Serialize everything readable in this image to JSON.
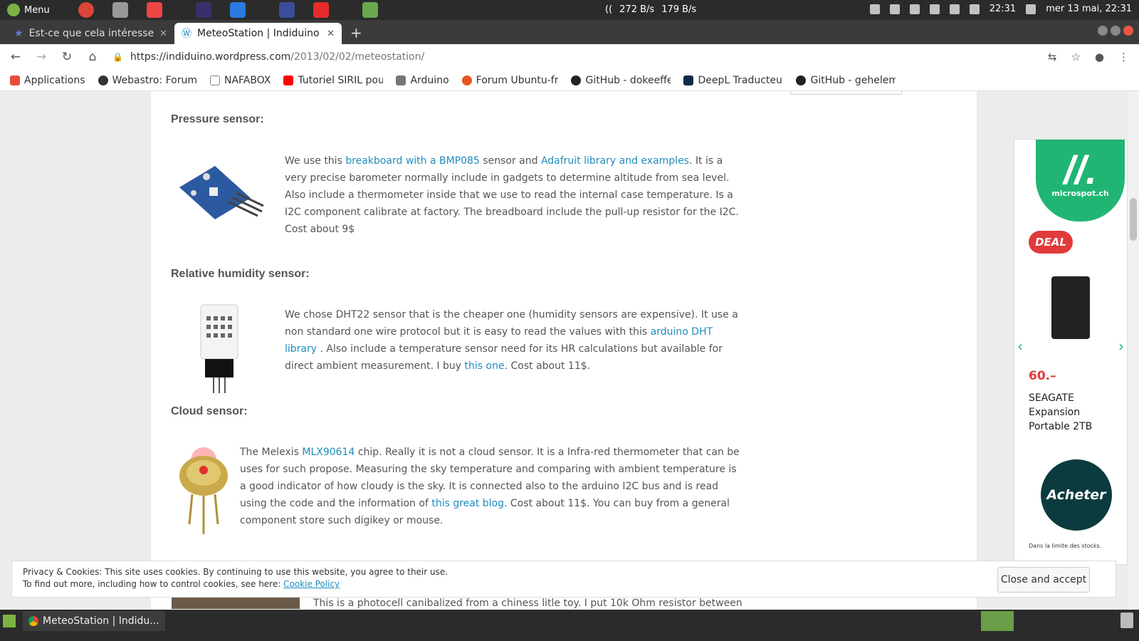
{
  "system": {
    "menu_label": "Menu",
    "net_down": "272 B/s",
    "net_up": "179 B/s",
    "time": "22:31",
    "date": "mer 13 mai, 22:31"
  },
  "tabs": [
    {
      "title": "Est-ce que cela intéresse",
      "active": false
    },
    {
      "title": "MeteoStation | Indiduino",
      "active": true
    }
  ],
  "address": {
    "host": "https://indiduino.wordpress.com",
    "path": "/2013/02/02/meteostation/"
  },
  "bookmarks": [
    {
      "label": "Applications",
      "color": "#e74c3c"
    },
    {
      "label": "Webastro: Forum",
      "color": "#333333"
    },
    {
      "label": "NAFABOX",
      "color": "#888888"
    },
    {
      "label": "Tutoriel SIRIL pour",
      "color": "#ff0000"
    },
    {
      "label": "Arduino",
      "color": "#777777"
    },
    {
      "label": "Forum Ubuntu-fr",
      "color": "#e95420"
    },
    {
      "label": "GitHub - dokeeffe",
      "color": "#222222"
    },
    {
      "label": "DeepL Traducteur",
      "color": "#0f2b46"
    },
    {
      "label": "GitHub - gehelem",
      "color": "#222222"
    }
  ],
  "article": {
    "pressure": {
      "heading": "Pressure sensor:",
      "p1": "We use this ",
      "link1": "breakboard with  a BMP085",
      "p2": " sensor and  ",
      "link2": "Adafruit library and examples",
      "p3": ". It is a very precise barometer normally include in gadgets to determine altitude from sea level. Also include a thermometer inside that we  use to read the internal case temperature. Is a I2C component calibrate at factory. The breadboard include the pull-up resistor for the I2C. Cost about 9$"
    },
    "humidity": {
      "heading": "Relative humidity sensor:",
      "p1": "We chose DHT22 sensor that is the cheaper one (humidity sensors are expensive). It use a non standard one wire protocol but it is easy to read the values with this ",
      "link1": "arduino DHT library",
      "p2": " . Also include a temperature sensor need for its HR calculations but available for direct ambient measurement. I buy ",
      "link2": "this one",
      "p3": ". Cost about 11$."
    },
    "cloud": {
      "heading": "Cloud sensor:",
      "p1": "The Melexis ",
      "link1": "MLX90614",
      "p2": " chip.  Really it is not a cloud sensor. It is a Infra-red thermometer that can be uses for such propose. Measuring the sky temperature and comparing with ambient temperature is a good indicator of how cloudy is the sky. It is connected also to the arduino I2C bus and is read using the code and the information of ",
      "link2": "this great blog",
      "p3": ". Cost about 11$. You can buy from a general component store such digikey or mouse."
    },
    "bottom_text": "This is a  photocell canibalized from a chiness litle toy. I put  10k Ohm  resistor between"
  },
  "ad": {
    "brand": "microspot.ch",
    "deal": "DEAL",
    "price": "60.–",
    "product": [
      "SEAGATE",
      "Expansion",
      "Portable 2TB"
    ],
    "cta": "Acheter",
    "stock_note": "Dans la limite des stocks.",
    "brand_color": "#21b573"
  },
  "cookie": {
    "line1": "Privacy & Cookies: This site uses cookies. By continuing to use this website, you agree to their use.",
    "line2": "To find out more, including how to control cookies, see here: ",
    "policy_link": "Cookie Policy",
    "button": "Close and accept"
  },
  "taskbar": {
    "window_title": "MeteoStation | Indidu..."
  }
}
